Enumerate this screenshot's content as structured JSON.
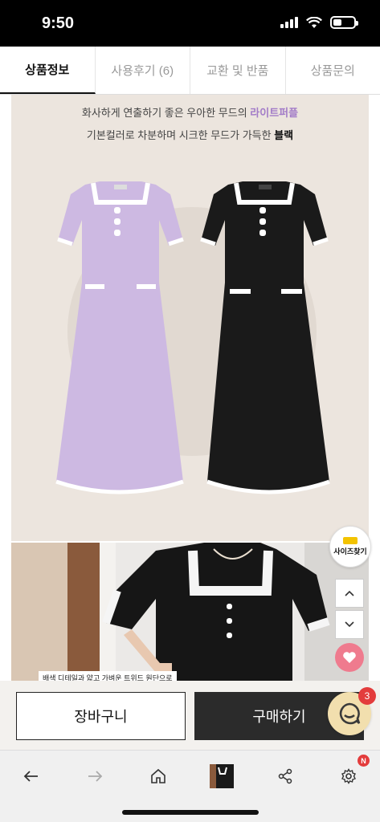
{
  "status_bar": {
    "time": "9:50",
    "battery_percent": 40
  },
  "tabs": [
    {
      "label": "상품정보",
      "active": true
    },
    {
      "label": "사용후기 (6)",
      "active": false
    },
    {
      "label": "교환 및 반품",
      "active": false
    },
    {
      "label": "상품문의",
      "active": false
    }
  ],
  "promo": {
    "line1_prefix": "화사하게 연출하기 좋은 우아한 무드의 ",
    "line1_highlight": "라이트퍼플",
    "line2_prefix": "기본컬러로 차분하며 시크한 무드가 가득한 ",
    "line2_highlight": "블랙",
    "highlight_purple": "#a37cc8"
  },
  "photo": {
    "caption": "배색 디테일과 얇고 가벼운 트위드 원단으로"
  },
  "floating": {
    "size_finder_label": "사이즈찾기",
    "chat_badge": "3"
  },
  "action_bar": {
    "cart_label": "장바구니",
    "buy_label": "구매하기"
  },
  "browser_bar": {
    "settings_badge": "N"
  },
  "colors": {
    "buy_button": "#2b2b2b",
    "heart": "#ef7b8e",
    "chat": "#f2dfae",
    "badge": "#e33c3c"
  }
}
